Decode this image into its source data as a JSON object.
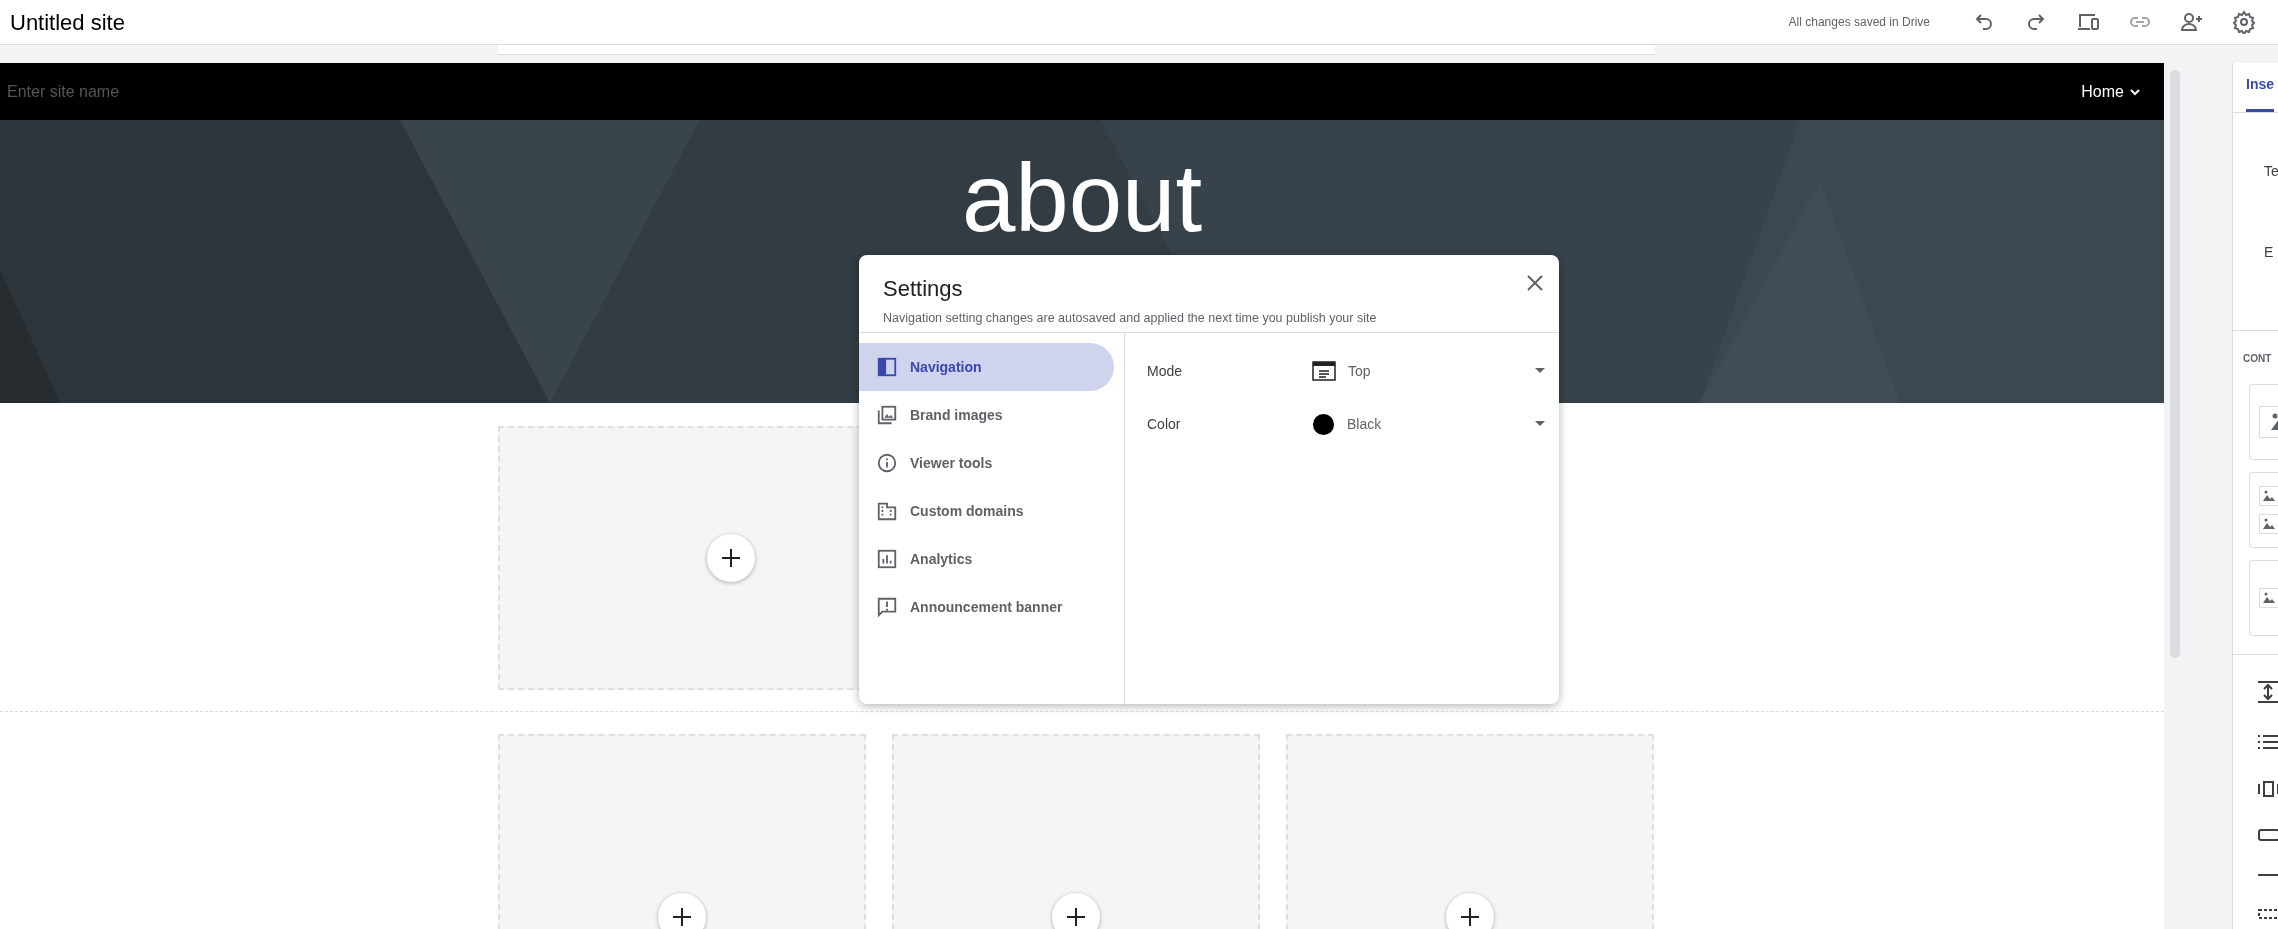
{
  "app_bar": {
    "title": "Untitled site",
    "save_status": "All changes saved in Drive"
  },
  "site_header": {
    "site_name": {
      "placeholder": "Enter site name"
    },
    "nav_item": "Home"
  },
  "hero": {
    "title": "about"
  },
  "sections": [
    {
      "columns": [
        {
          "kind": "placeholder"
        }
      ]
    },
    {
      "columns": [
        {
          "kind": "placeholder"
        },
        {
          "kind": "placeholder"
        },
        {
          "kind": "placeholder"
        }
      ]
    }
  ],
  "dialog": {
    "title": "Settings",
    "subtitle": "Navigation setting changes are autosaved and applied the next time you publish your site",
    "nav": [
      {
        "label": "Navigation",
        "selected": true
      },
      {
        "label": "Brand images",
        "selected": false
      },
      {
        "label": "Viewer tools",
        "selected": false
      },
      {
        "label": "Custom domains",
        "selected": false
      },
      {
        "label": "Analytics",
        "selected": false
      },
      {
        "label": "Announcement banner",
        "selected": false
      }
    ],
    "fields": [
      {
        "label": "Mode",
        "value": "Top",
        "kind": "layout"
      },
      {
        "label": "Color",
        "value": "Black",
        "kind": "swatch"
      }
    ]
  },
  "side_panel": {
    "tabs": [
      {
        "label": "Inse",
        "selected": true
      }
    ],
    "items": [
      "Te",
      "E"
    ],
    "section_heading": "CONT"
  }
}
